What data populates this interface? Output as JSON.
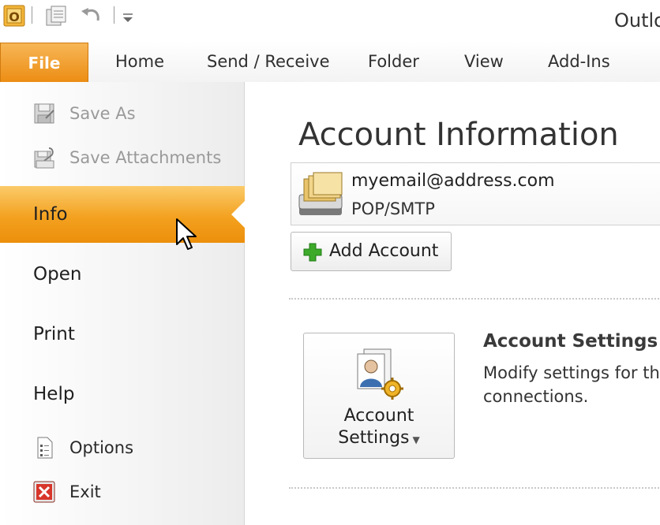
{
  "window": {
    "title": "Outlo"
  },
  "icons": {
    "app": "outlook-icon",
    "qat": [
      "send-receive-all-icon",
      "undo-icon",
      "customize-qat-icon"
    ],
    "nav": [
      "save-as-icon",
      "save-attachments-icon",
      "options-icon",
      "exit-icon"
    ],
    "account": "account-folders-icon",
    "add": "plus-icon",
    "settings": "account-settings-icon"
  },
  "colors": {
    "accent": "#F0941A",
    "file_tab": "#EC8D14",
    "plus": "#3DAA2A",
    "exit": "#D8362B"
  },
  "ribbon": {
    "file_tab": "File",
    "tabs": [
      "Home",
      "Send / Receive",
      "Folder",
      "View",
      "Add-Ins"
    ]
  },
  "nav": {
    "commands_top": [
      {
        "label": "Save As",
        "enabled": false
      },
      {
        "label": "Save Attachments",
        "enabled": false
      }
    ],
    "items": [
      {
        "label": "Info",
        "selected": true
      },
      {
        "label": "Open",
        "selected": false
      },
      {
        "label": "Print",
        "selected": false
      },
      {
        "label": "Help",
        "selected": false
      }
    ],
    "commands_bottom": [
      {
        "label": "Options"
      },
      {
        "label": "Exit"
      }
    ]
  },
  "main": {
    "heading": "Account Information",
    "account": {
      "email": "myemail@address.com",
      "type": "POP/SMTP"
    },
    "add_account_label": "Add Account",
    "settings": {
      "button_line1": "Account",
      "button_line2": "Settings",
      "title": "Account Settings",
      "desc_line1": "Modify settings for th",
      "desc_line2": "connections."
    }
  }
}
